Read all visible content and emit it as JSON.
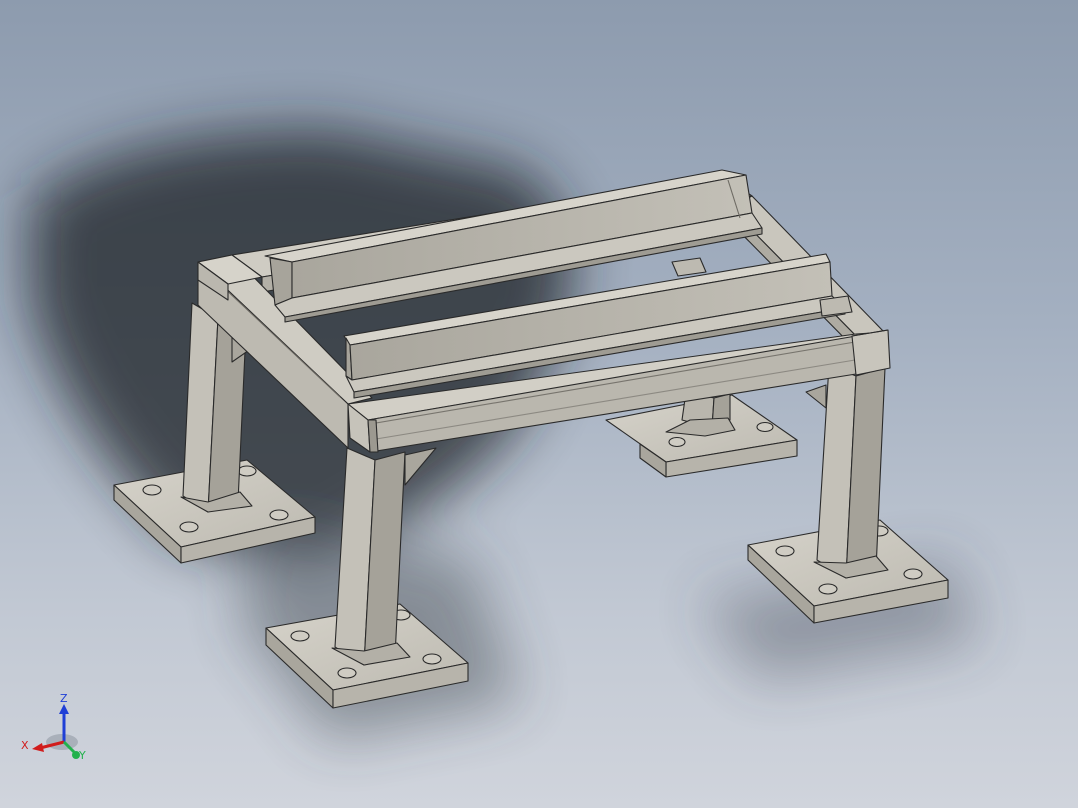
{
  "viewport": {
    "background_top": "#8d9bae",
    "background_bottom": "#d0d4dc",
    "model_face_color": "#bcb9b0",
    "model_edge_color": "#2a2a2a"
  },
  "triad": {
    "x_label": "X",
    "y_label": "Y",
    "z_label": "Z",
    "x_color": "#d11c1c",
    "y_color": "#22b14c",
    "z_color": "#1f3fd6"
  }
}
